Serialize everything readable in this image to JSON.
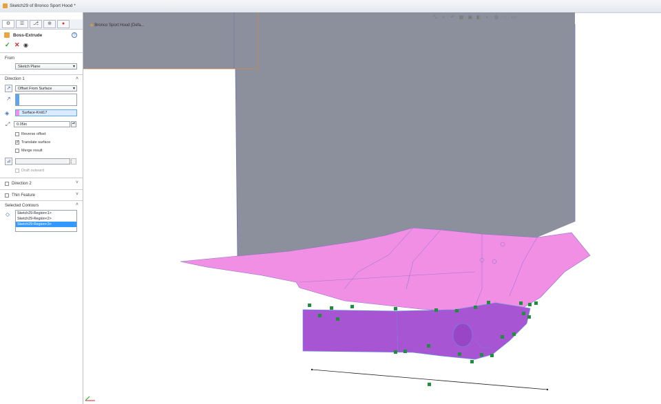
{
  "window": {
    "title": "Sketch29 of Bronco Sport Hood *"
  },
  "feature": {
    "name": "Boss-Extrude",
    "from": {
      "label": "From",
      "value": "Sketch Plane"
    },
    "direction1": {
      "label": "Direction 1",
      "end_condition": "Offset From Surface",
      "face": "Surface-Knit17",
      "offset": "0.05in",
      "options": [
        {
          "label": "Reverse offset",
          "checked": false
        },
        {
          "label": "Translate surface",
          "checked": true
        },
        {
          "label": "Merge result",
          "checked": false
        }
      ],
      "draft_label": "Draft outward"
    },
    "direction2": {
      "label": "Direction 2"
    },
    "thin_feature": {
      "label": "Thin Feature"
    },
    "selected_contours": {
      "label": "Selected Contours",
      "items": [
        {
          "label": "Sketch29-Region<1>",
          "selected": false
        },
        {
          "label": "Sketch29-Region<2>",
          "selected": false
        },
        {
          "label": "Sketch29-Region<3>",
          "selected": true
        }
      ]
    }
  },
  "breadcrumb": {
    "label": "Bronco Sport Hood (Defa..."
  },
  "colors": {
    "surface_gray": "#8c8f9c",
    "surface_pink": "#f08fe3",
    "region_purple": "#a855d4",
    "selection_blue": "#3399ff"
  }
}
